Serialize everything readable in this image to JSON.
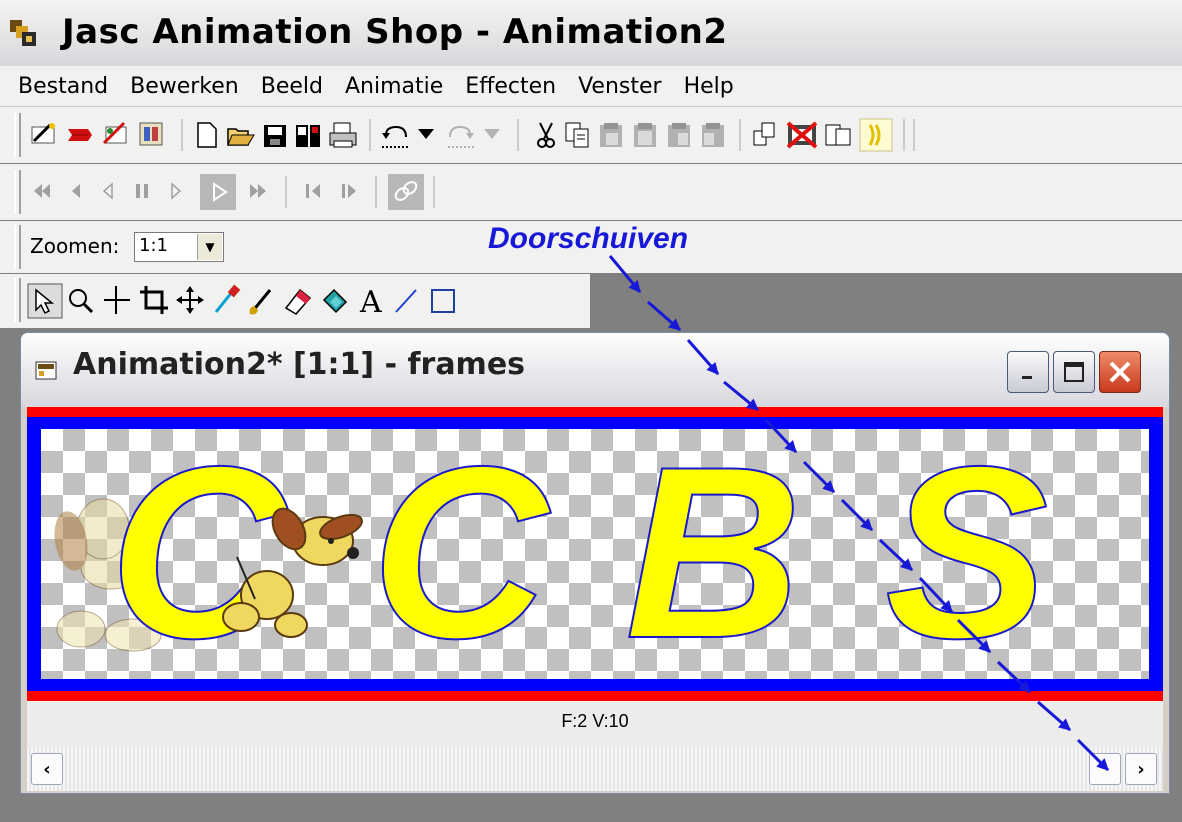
{
  "app": {
    "title": "Jasc Animation Shop - Animation2"
  },
  "menu": {
    "items": [
      "Bestand",
      "Bewerken",
      "Beeld",
      "Animatie",
      "Effecten",
      "Venster",
      "Help"
    ]
  },
  "zoom": {
    "label": "Zoomen:",
    "value": "1:1"
  },
  "annotation": {
    "text": "Doorschuiven"
  },
  "document": {
    "title": "Animation2* [1:1] - frames",
    "frame_info": "F:2  V:10",
    "letters": [
      "C",
      "C",
      "B",
      "S"
    ]
  },
  "icons": {
    "toolbar_main": [
      "animation-wizard-icon",
      "banner-wizard-icon",
      "optimization-wizard-icon",
      "view-animation-icon",
      "new-icon",
      "open-icon",
      "save-icon",
      "save-as-icon",
      "print-icon",
      "undo-icon",
      "undo-dropdown-icon",
      "redo-icon",
      "redo-dropdown-icon",
      "cut-icon",
      "copy-icon",
      "paste-as-new-icon",
      "paste-into-icon",
      "paste-before-icon",
      "paste-after-icon",
      "duplicate-icon",
      "delete-icon",
      "select-all-icon",
      "view-effect-icon"
    ],
    "toolbar_play": [
      "first-frame-icon",
      "previous-frame-icon",
      "step-back-icon",
      "pause-icon",
      "step-forward-icon",
      "play-icon",
      "last-frame-icon",
      "previous-icon",
      "next-icon",
      "link-icon"
    ],
    "toolbar_tools": [
      "arrow-tool-icon",
      "zoom-tool-icon",
      "crosshair-tool-icon",
      "crop-tool-icon",
      "move-tool-icon",
      "dropper-tool-icon",
      "paintbrush-tool-icon",
      "eraser-tool-icon",
      "fill-tool-icon",
      "text-tool-icon",
      "line-tool-icon",
      "rectangle-tool-icon"
    ]
  },
  "colors": {
    "annotation_blue": "#1818d8",
    "letter_fill": "#ffff00",
    "letter_outline": "#1a1acc",
    "frame_red": "#ff0000",
    "frame_blue": "#0000ff",
    "close_button": "#d9492a"
  }
}
